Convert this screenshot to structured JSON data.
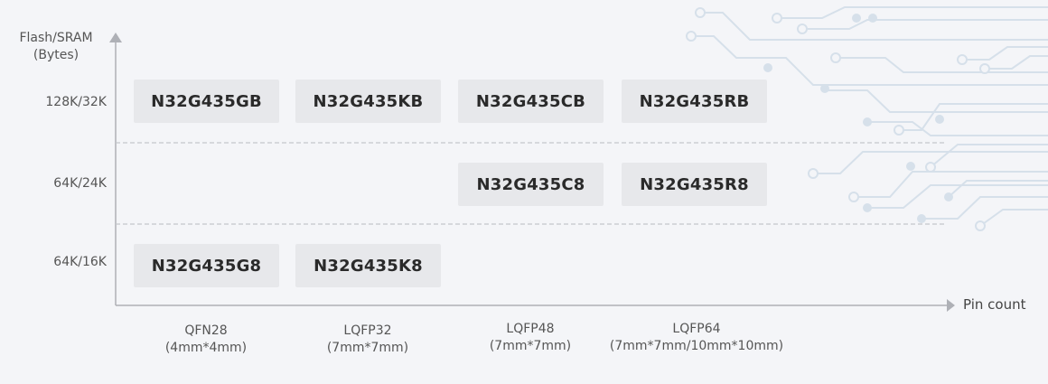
{
  "axes": {
    "y_label_line1": "Flash/SRAM",
    "y_label_line2": "(Bytes)",
    "x_label": "Pin count"
  },
  "rows": [
    {
      "label": "128K/32K"
    },
    {
      "label": "64K/24K"
    },
    {
      "label": "64K/16K"
    }
  ],
  "packages": [
    {
      "name": "QFN28",
      "size": "(4mm*4mm)"
    },
    {
      "name": "LQFP32",
      "size": "(7mm*7mm)"
    },
    {
      "name": "LQFP48",
      "size": "(7mm*7mm)"
    },
    {
      "name": "LQFP64",
      "size": "(7mm*7mm/10mm*10mm)"
    }
  ],
  "parts": [
    {
      "name": "N32G435GB",
      "row": 0,
      "col": 0
    },
    {
      "name": "N32G435KB",
      "row": 0,
      "col": 1
    },
    {
      "name": "N32G435CB",
      "row": 0,
      "col": 2
    },
    {
      "name": "N32G435RB",
      "row": 0,
      "col": 3
    },
    {
      "name": "N32G435C8",
      "row": 1,
      "col": 2
    },
    {
      "name": "N32G435R8",
      "row": 1,
      "col": 3
    },
    {
      "name": "N32G435G8",
      "row": 2,
      "col": 0
    },
    {
      "name": "N32G435K8",
      "row": 2,
      "col": 1
    }
  ],
  "colors": {
    "background": "#f4f5f8",
    "chip_fill": "#e7e8eb",
    "axis": "#aeb0b6",
    "divider": "#c4c6cb",
    "circuit": "#d4dfea"
  }
}
